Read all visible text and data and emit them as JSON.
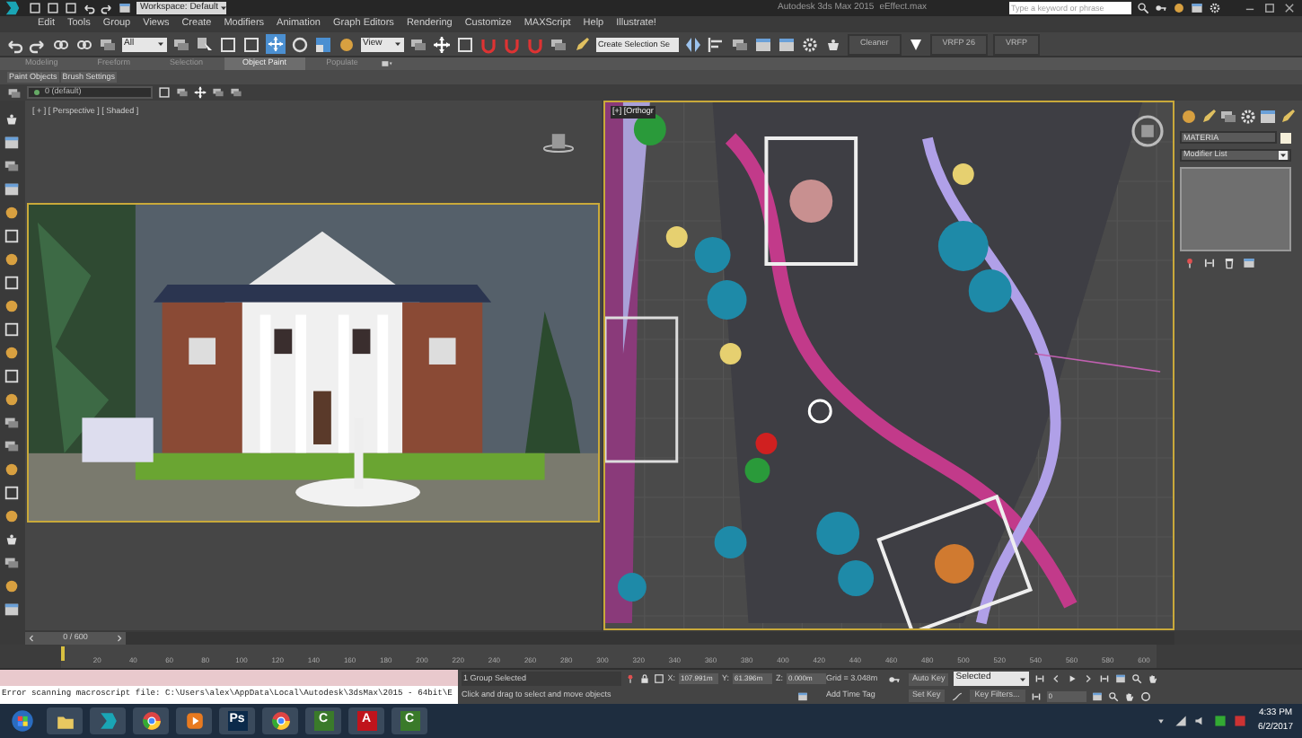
{
  "title_bar": {
    "workspace": "Workspace: Default",
    "title": "Autodesk 3ds Max 2015",
    "file": "eEffect.max",
    "search": {
      "placeholder": "Type a keyword or phrase"
    }
  },
  "menu": [
    "Edit",
    "Tools",
    "Group",
    "Views",
    "Create",
    "Modifiers",
    "Animation",
    "Graph Editors",
    "Rendering",
    "Customize",
    "MAXScript",
    "Help",
    "Illustrate!"
  ],
  "toolbar": {
    "selection_filter": "All",
    "reference_coord": "View",
    "named_selection": "Create Selection Se",
    "buttons": [
      "Cleaner",
      "VRFP 26",
      "VRFP"
    ]
  },
  "ribbon": {
    "tabs": [
      {
        "label": "Modeling",
        "selected": false
      },
      {
        "label": "Freeform",
        "selected": false
      },
      {
        "label": "Selection",
        "selected": false
      },
      {
        "label": "Object Paint",
        "selected": true
      },
      {
        "label": "Populate",
        "selected": false
      }
    ],
    "panels": [
      "Paint Objects",
      "Brush Settings"
    ]
  },
  "layer": "0 (default)",
  "viewports": [
    {
      "kind": "perspective",
      "label": "[ + ] [ Perspective ] [ Shaded ]"
    },
    {
      "kind": "plan",
      "label": "[+] [Orthogr"
    }
  ],
  "command_panel": {
    "object_name": "MATERIA",
    "modifier_list": "Modifier List"
  },
  "timeline": {
    "position": "0 / 600",
    "level": 0,
    "ticks": [
      "20",
      "40",
      "60",
      "80",
      "100",
      "120",
      "140",
      "160",
      "180",
      "200",
      "220",
      "240",
      "260",
      "280",
      "300",
      "320",
      "340",
      "360",
      "380",
      "400",
      "420",
      "440",
      "460",
      "480",
      "500",
      "520",
      "540",
      "560",
      "580",
      "600"
    ]
  },
  "status": {
    "listener_output": "Error scanning macroscript file: C:\\Users\\alex\\AppData\\Local\\Autodesk\\3dsMax\\2015 - 64bit\\E",
    "selection": "1 Group Selected",
    "prompt": "Click and drag to select and move objects",
    "coords": [
      {
        "label": "X:",
        "value": "107.991m"
      },
      {
        "label": "Y:",
        "value": "61.396m"
      },
      {
        "label": "Z:",
        "value": "0.000m"
      }
    ],
    "grid": "Grid = 3.048m",
    "add_time_tag": "Add Time Tag",
    "auto_key": "Auto Key",
    "key_mode": "Selected",
    "set_key": "Set Key",
    "key_filters": "Key Filters...",
    "frame": "0"
  },
  "taskbar": {
    "apps": [
      {
        "kind": "start"
      },
      {
        "kind": "folder"
      },
      {
        "kind": "max"
      },
      {
        "kind": "chrome"
      },
      {
        "kind": "player"
      },
      {
        "kind": "letter",
        "text": "Ps",
        "color": "#0b2a4a"
      },
      {
        "kind": "chrome"
      },
      {
        "kind": "letter",
        "text": "C",
        "color": "#3a7a2a"
      },
      {
        "kind": "letter",
        "text": "A",
        "color": "#c0141c"
      },
      {
        "kind": "letter",
        "text": "C",
        "color": "#3a7a2a"
      }
    ],
    "time": "4:33 PM",
    "date": "6/2/2017"
  }
}
